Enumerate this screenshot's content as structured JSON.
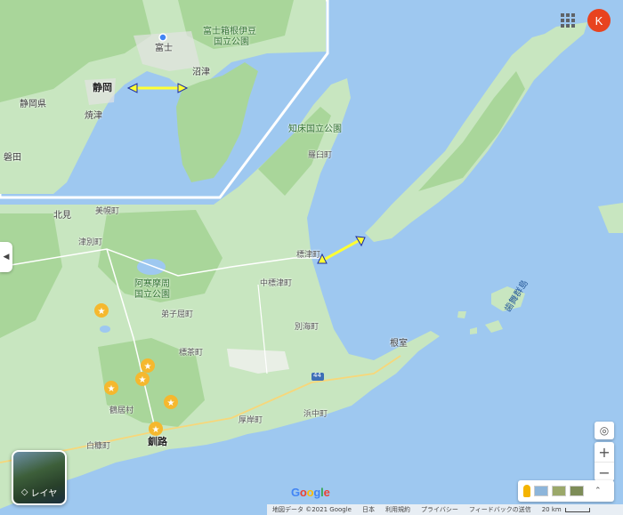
{
  "colors": {
    "water": "#9ec8f0",
    "land": "#c8e6c0",
    "forest": "#a9d69a",
    "accent_arrow": "#ffff33",
    "arrow_outline": "#1a2aa6"
  },
  "inset_labels": {
    "shizuoka_pref": "静岡県",
    "shizuoka": "静岡",
    "yaizu": "焼津",
    "iwata": "磐田",
    "numazu": "沼津",
    "fuji": "富士",
    "park_line1": "富士箱根伊豆",
    "park_line2": "国立公園"
  },
  "labels": {
    "kitami": "北見",
    "bihoro": "美幌町",
    "tsubetsu": "津別町",
    "akan_park_1": "阿寒摩周",
    "akan_park_2": "国立公園",
    "teshikaga": "弟子屈町",
    "shibecha": "標茶町",
    "kushiro": "釧路",
    "shiranuka": "白糠町",
    "shiretoko_park": "知床国立公園",
    "rausu": "羅臼町",
    "shibetsu": "標津町",
    "nakashibetsu": "中標津町",
    "betsukai": "別海町",
    "nemuro": "根室",
    "hamanaka": "浜中町",
    "akkeshi": "厚岸町",
    "tsurui": "鶴居村",
    "habomai": "歯舞群島",
    "route": "44"
  },
  "header": {
    "avatar_letter": "K"
  },
  "layers_button": {
    "label": "レイヤ"
  },
  "branding": {
    "logo": "Google"
  },
  "attribution": {
    "map_data": "地図データ ©2021 Google",
    "country": "日本",
    "terms": "利用規約",
    "privacy": "プライバシー",
    "feedback": "フィードバックの送信",
    "scale": "20 km"
  },
  "controls": {
    "zoom_in": "+",
    "zoom_out": "−",
    "my_location_icon": "◎",
    "side_toggle": "◀",
    "expand": "⌃"
  }
}
